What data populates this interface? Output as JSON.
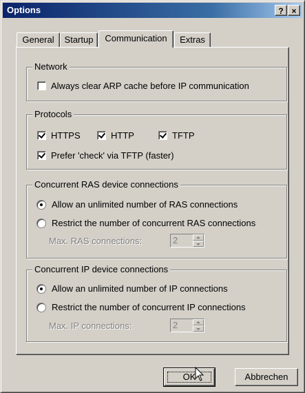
{
  "window": {
    "title": "Options",
    "help_button": "?",
    "close_button": "×"
  },
  "tabs": [
    {
      "label": "General",
      "active": false
    },
    {
      "label": "Startup",
      "active": false
    },
    {
      "label": "Communication",
      "active": true
    },
    {
      "label": "Extras",
      "active": false
    }
  ],
  "network": {
    "title": "Network",
    "clear_arp": {
      "label": "Always clear ARP cache before IP communication",
      "checked": false
    }
  },
  "protocols": {
    "title": "Protocols",
    "https": {
      "label": "HTTPS",
      "checked": true
    },
    "http": {
      "label": "HTTP",
      "checked": true
    },
    "tftp": {
      "label": "TFTP",
      "checked": true
    },
    "prefer_check": {
      "label": "Prefer 'check' via TFTP (faster)",
      "checked": true
    }
  },
  "ras": {
    "title": "Concurrent RAS device connections",
    "unlimited": {
      "label": "Allow an unlimited number of RAS connections",
      "selected": true
    },
    "restrict": {
      "label": "Restrict the number of concurrent RAS connections",
      "selected": false
    },
    "max_label": "Max. RAS connections:",
    "max_value": "2"
  },
  "ip": {
    "title": "Concurrent IP device connections",
    "unlimited": {
      "label": "Allow an unlimited number of IP connections",
      "selected": true
    },
    "restrict": {
      "label": "Restrict the number of concurrent IP connections",
      "selected": false
    },
    "max_label": "Max. IP connections:",
    "max_value": "2"
  },
  "buttons": {
    "ok": "OK",
    "cancel": "Abbrechen"
  },
  "icons": {
    "cursor": "mouse-pointer-icon"
  }
}
